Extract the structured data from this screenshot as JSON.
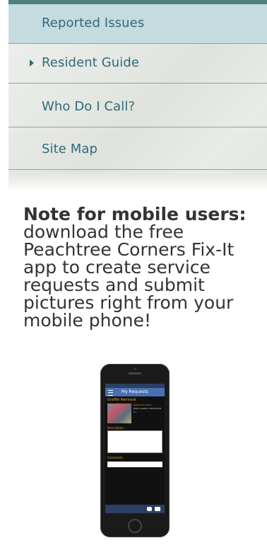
{
  "nav": {
    "items": [
      {
        "label": "Reported Issues",
        "active": true,
        "caret": false
      },
      {
        "label": "Resident Guide",
        "active": false,
        "caret": true
      },
      {
        "label": "Who Do I Call?",
        "active": false,
        "caret": false
      },
      {
        "label": "Site Map",
        "active": false,
        "caret": false
      }
    ]
  },
  "note": {
    "heading": "Note for mobile users:",
    "body_lines": [
      "download the free",
      "Peachtree Corners Fix-It",
      "app to create service",
      "requests and submit",
      "pictures right from your",
      "mobile phone!"
    ]
  },
  "phone_screen": {
    "title": "My Requests",
    "request_type": "Graffiti Removal",
    "request_id": "Report ID: 10111",
    "date_created": "Date Created: 2015/02/18 4:...",
    "description_label": "Description:",
    "comments_label": "Comments:"
  },
  "colors": {
    "topbar": "#4f7f7e",
    "nav_text": "#2f6a78",
    "active_bg": "#c4dbe0"
  }
}
